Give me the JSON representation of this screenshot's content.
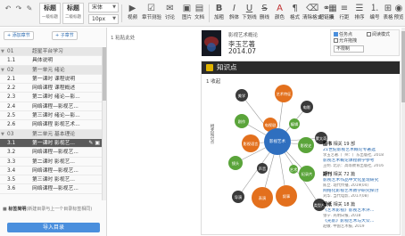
{
  "toolbar": {
    "style1": {
      "big": "标题",
      "small": "一级标题"
    },
    "style2": {
      "big": "标题",
      "small": "二级标题"
    },
    "font": "宋体",
    "size": "10px",
    "buttons": [
      {
        "label": "视频",
        "icon": "video-icon"
      },
      {
        "label": "章节测验",
        "icon": "quiz-icon"
      },
      {
        "label": "讨论",
        "icon": "discussion-icon"
      },
      {
        "label": "图片",
        "icon": "image-icon"
      },
      {
        "label": "文档",
        "icon": "document-icon"
      },
      {
        "label": "加粗",
        "icon": "bold-icon"
      },
      {
        "label": "斜体",
        "icon": "italic-icon"
      },
      {
        "label": "下划线",
        "icon": "underline-icon"
      },
      {
        "label": "删线",
        "icon": "strikethrough-icon"
      },
      {
        "label": "颜色",
        "icon": "color-icon"
      },
      {
        "label": "格式",
        "icon": "format-icon"
      },
      {
        "label": "清除格式",
        "icon": "clear-format-icon"
      },
      {
        "label": "超链接",
        "icon": "link-icon"
      },
      {
        "label": "表",
        "icon": "table-icon"
      },
      {
        "label": "行距",
        "icon": "line-spacing-icon"
      },
      {
        "label": "排序",
        "icon": "sort-icon"
      },
      {
        "label": "编号",
        "icon": "numbering-icon"
      },
      {
        "label": "表格",
        "icon": "grid-icon"
      },
      {
        "label": "预览",
        "icon": "preview-icon"
      }
    ]
  },
  "outline": {
    "add_chapter": "+ 添加章节",
    "add_unit": "+ 子章节",
    "rows": [
      {
        "num": "01",
        "title": "超星平台学习",
        "type": "chapter"
      },
      {
        "num": "1.1",
        "title": "具体说明",
        "type": "item"
      },
      {
        "num": "02",
        "title": "第一单元 绪论",
        "type": "chapter"
      },
      {
        "num": "2.1",
        "title": "第一课时 课程说明",
        "type": "item"
      },
      {
        "num": "2.2",
        "title": "网络课程 课程概述",
        "type": "item"
      },
      {
        "num": "2.3",
        "title": "第二课时 绪论—影...",
        "type": "item"
      },
      {
        "num": "2.4",
        "title": "网络课程—影视艺...",
        "type": "item"
      },
      {
        "num": "2.5",
        "title": "第三课时 绪论—影...",
        "type": "item"
      },
      {
        "num": "2.6",
        "title": "网络课程 影视艺术...",
        "type": "item"
      },
      {
        "num": "03",
        "title": "第二单元 基本理论",
        "type": "chapter"
      },
      {
        "num": "3.1",
        "title": "第一课时 影视艺...",
        "type": "selected"
      },
      {
        "num": "3.2",
        "title": "网络课程—影视艺...",
        "type": "item"
      },
      {
        "num": "3.3",
        "title": "第二课时 影视艺...",
        "type": "item"
      },
      {
        "num": "3.4",
        "title": "网络课程—影视艺...",
        "type": "item"
      },
      {
        "num": "3.5",
        "title": "第三课时 影视艺...",
        "type": "item"
      },
      {
        "num": "3.6",
        "title": "网络课程—影视艺...",
        "type": "item"
      }
    ],
    "tag_label": "标签简明",
    "tag_text": "(新建目录与上一个目录标签相同)",
    "import_btn": "导入目录"
  },
  "center": {
    "text": "1 粘贴此处"
  },
  "book": {
    "title": "影视艺术概论",
    "author": "李玉艺著",
    "date": "2014.07"
  },
  "options": {
    "opt1": "任务点",
    "opt2": "阅读模式",
    "opt3": "允许拖拽",
    "select": "不限制"
  },
  "knowledge": {
    "header": "知识点",
    "sub": "1 收起",
    "side_label": "相关知识点",
    "nodes": {
      "center": "影视艺术",
      "n1": "美学",
      "n2": "艺术特征",
      "n3": "电影",
      "n4": "剧作",
      "n5": "影视语言",
      "n6": "蒙太奇",
      "n7": "镜头",
      "n8": "纪录片",
      "n9": "表演",
      "n10": "叙事",
      "n11": "类型片",
      "n12": "导演",
      "n13": "影视史",
      "n14": "电视剧",
      "n15": "编辑",
      "n16": "声音",
      "n17": "艺术"
    }
  },
  "refs": [
    {
      "tag": "图书",
      "meta_h": "相关 19 部",
      "l1": "21世纪影视艺术概论专著选",
      "m1": "李玉艺著. 广州：广东出版社, 2018",
      "l2": "影视艺术概论课程教学参考",
      "m2": "王明. 北京：高等教育出版社, 2016"
    },
    {
      "tag": "期刊",
      "meta_h": "相关 72 篇",
      "l1": "影视艺术作品中文化呈现研究",
      "m1": "陈立. 现代传播, 2019(04)",
      "l2": "网络化影视艺术教学研究探讨",
      "m2": "刘华. 当代电影, 2017(08)"
    },
    {
      "tag": "报纸",
      "meta_h": "相关 18 篇",
      "l1": "《艺术影视》影视艺术评…",
      "m1": "张宁. 光明日报, 2018",
      "l2": "《光影》影视艺术与大众…",
      "m2": "赵敏. 中国艺术报, 2019"
    }
  ]
}
